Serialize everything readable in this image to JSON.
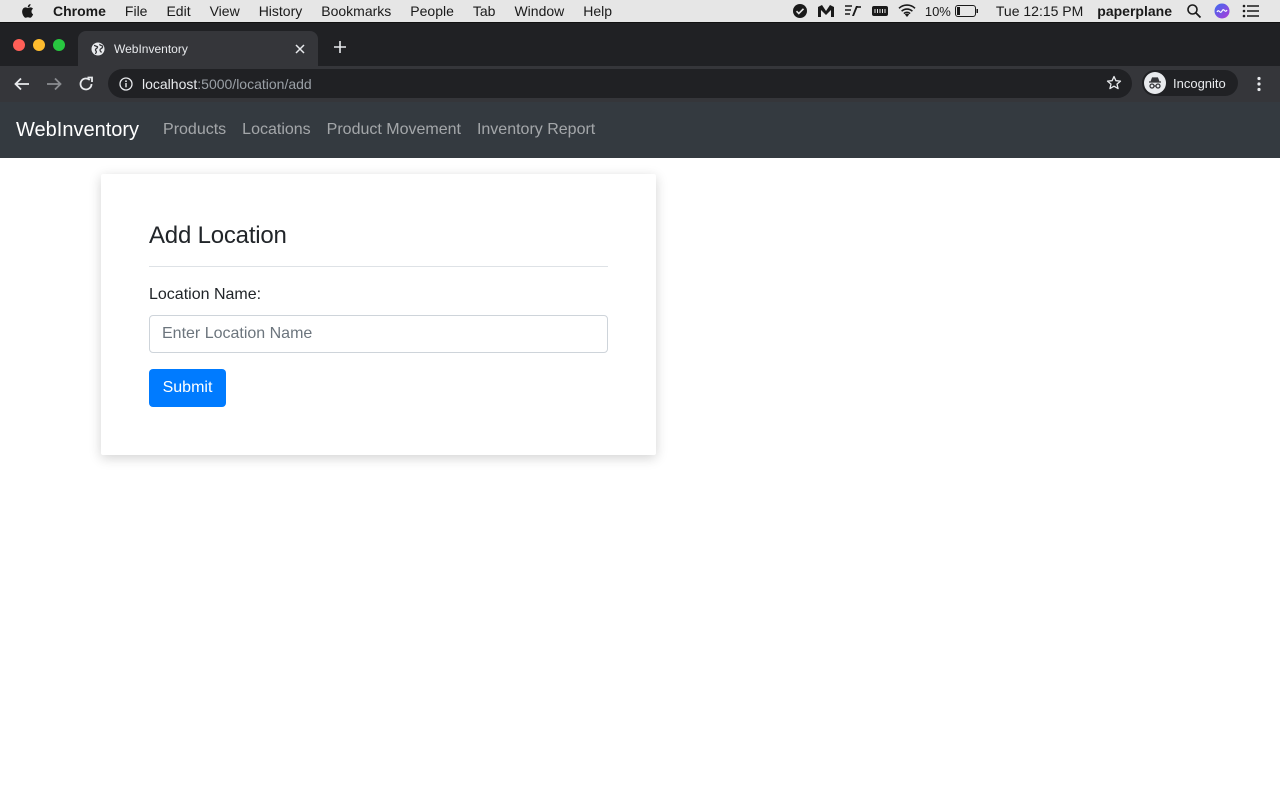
{
  "menubar": {
    "app_name": "Chrome",
    "items": [
      "File",
      "Edit",
      "View",
      "History",
      "Bookmarks",
      "People",
      "Tab",
      "Window",
      "Help"
    ],
    "battery_percent": "10%",
    "clock": "Tue 12:15 PM",
    "user": "paperplane"
  },
  "browser": {
    "tab_title": "WebInventory",
    "url_host": "localhost",
    "url_rest": ":5000/location/add",
    "profile_label": "Incognito"
  },
  "navbar": {
    "brand": "WebInventory",
    "links": [
      "Products",
      "Locations",
      "Product Movement",
      "Inventory Report"
    ]
  },
  "form": {
    "title": "Add Location",
    "field_label": "Location Name:",
    "field_value": "",
    "field_placeholder": "Enter Location Name",
    "submit_label": "Submit"
  },
  "colors": {
    "navbar_bg": "#343a40",
    "primary": "#007bff"
  }
}
